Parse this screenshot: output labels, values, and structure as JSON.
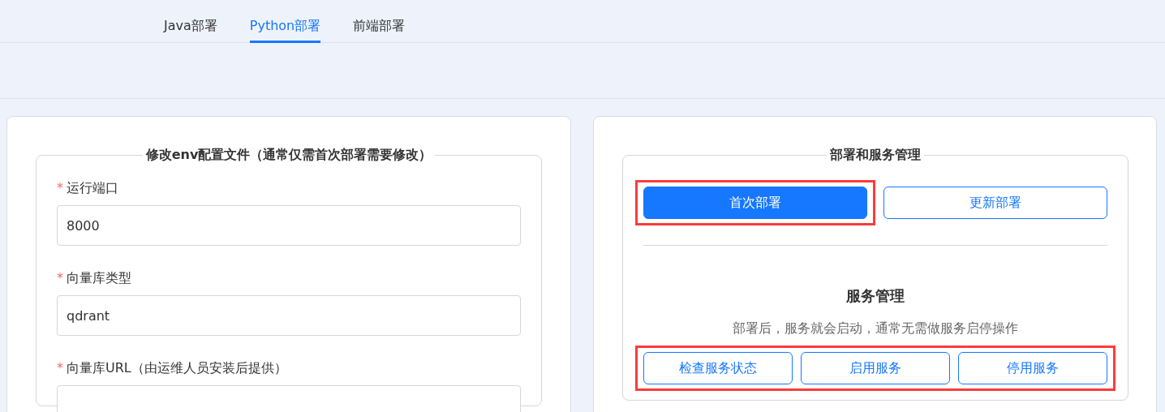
{
  "tabs": [
    {
      "label": "Java部署",
      "selected": false
    },
    {
      "label": "Python部署",
      "selected": true
    },
    {
      "label": "前端部署",
      "selected": false
    }
  ],
  "config_panel": {
    "legend": "修改env配置文件（通常仅需首次部署需要修改）",
    "fields": [
      {
        "label": "运行端口",
        "required_mark": "*",
        "value": "8000"
      },
      {
        "label": "向量库类型",
        "required_mark": "*",
        "value": "qdrant"
      },
      {
        "label": "向量库URL（由运维人员安装后提供）",
        "required_mark": "*"
      }
    ]
  },
  "deploy_panel": {
    "legend": "部署和服务管理",
    "deploy_buttons": [
      {
        "label": "首次部署",
        "kind": "primary",
        "highlighted": true
      },
      {
        "label": "更新部署",
        "kind": "outline",
        "highlighted": false
      }
    ],
    "service_title": "服务管理",
    "service_description": "部署后，服务就会启动，通常无需做服务启停操作",
    "service_buttons": {
      "highlighted": true,
      "buttons": [
        {
          "label": "检查服务状态",
          "kind": "outline"
        },
        {
          "label": "启用服务",
          "kind": "outline"
        },
        {
          "label": "停用服务",
          "kind": "outline"
        }
      ]
    }
  }
}
